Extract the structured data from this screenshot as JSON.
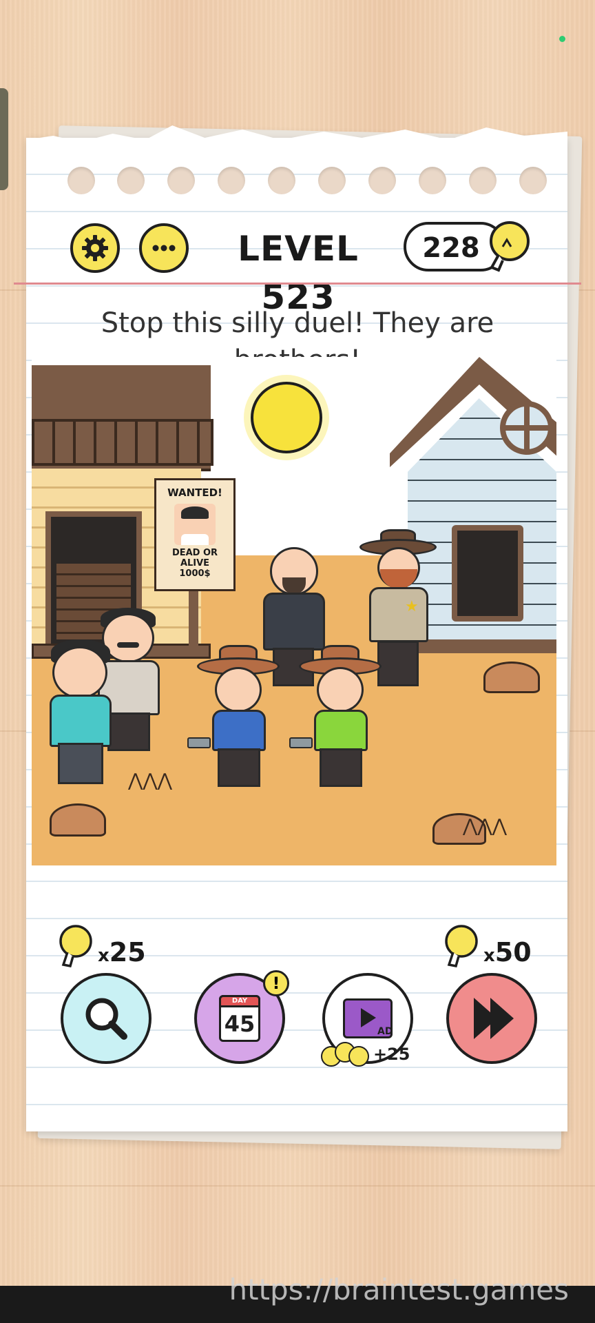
{
  "header": {
    "settings_icon": "gear-icon",
    "menu_icon": "more-dots-icon",
    "level_title": "LEVEL 523",
    "hint_count": "228",
    "hint_icon": "lightbulb-icon"
  },
  "question": "Stop this silly duel! They are brothers!",
  "scene": {
    "wanted_title": "WANTED!",
    "wanted_text_line1": "DEAD OR ALIVE",
    "wanted_text_line2": "1000$"
  },
  "toolbar": {
    "magnify": {
      "icon": "magnifier-icon",
      "cost": "25",
      "cost_prefix": "x"
    },
    "daily": {
      "icon": "calendar-icon",
      "day_label": "DAY",
      "day_number": "45",
      "badge": "!"
    },
    "ad": {
      "icon": "video-ad-icon",
      "ad_label": "AD",
      "reward": "+25"
    },
    "skip": {
      "icon": "skip-icon",
      "cost": "50",
      "cost_prefix": "x"
    }
  },
  "watermark": "https://braintest.games",
  "colors": {
    "accent_yellow": "#f7e45a",
    "magnify_bg": "#c9f1f4",
    "daily_bg": "#d6a5e8",
    "skip_bg": "#f08c8c",
    "ground": "#eeb568"
  }
}
